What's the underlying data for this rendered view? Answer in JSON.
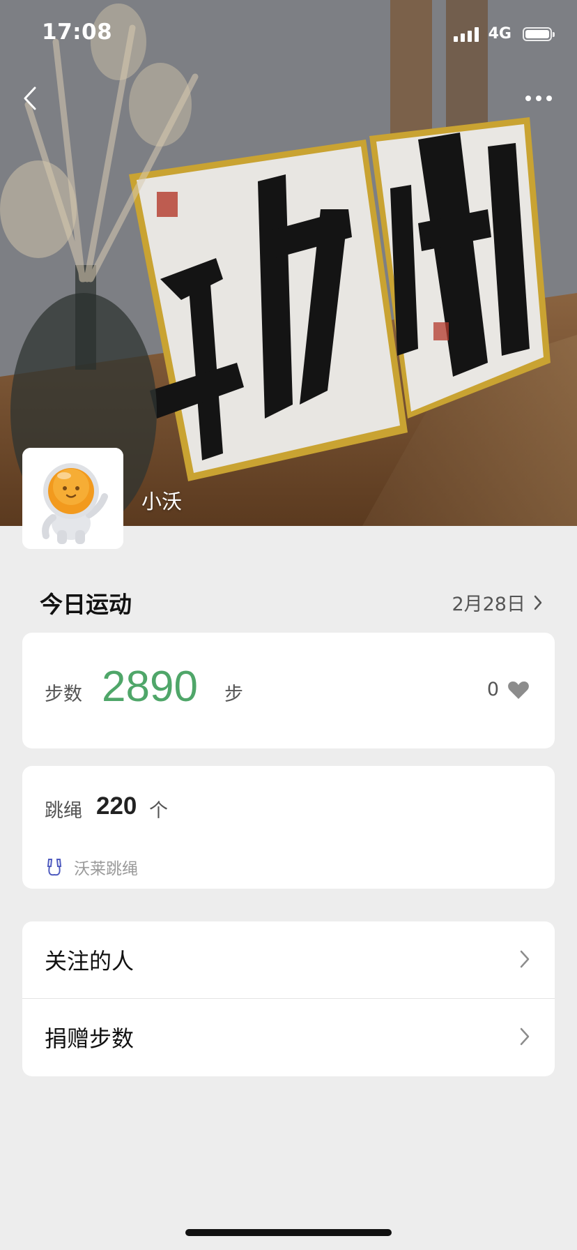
{
  "status_bar": {
    "time": "17:08",
    "network": "4G"
  },
  "nav": {
    "back_icon": "chevron-left-icon",
    "more_icon": "more-dots-icon"
  },
  "profile": {
    "nickname": "小沃"
  },
  "today": {
    "title": "今日运动",
    "date": "2月28日"
  },
  "steps": {
    "label": "步数",
    "value": "2890",
    "unit": "步",
    "likes": "0",
    "accent": "#4fa669"
  },
  "jump_rope": {
    "label": "跳绳",
    "value": "220",
    "unit": "个",
    "source": "沃莱跳绳"
  },
  "menu": [
    {
      "label": "关注的人"
    },
    {
      "label": "捐赠步数"
    }
  ]
}
